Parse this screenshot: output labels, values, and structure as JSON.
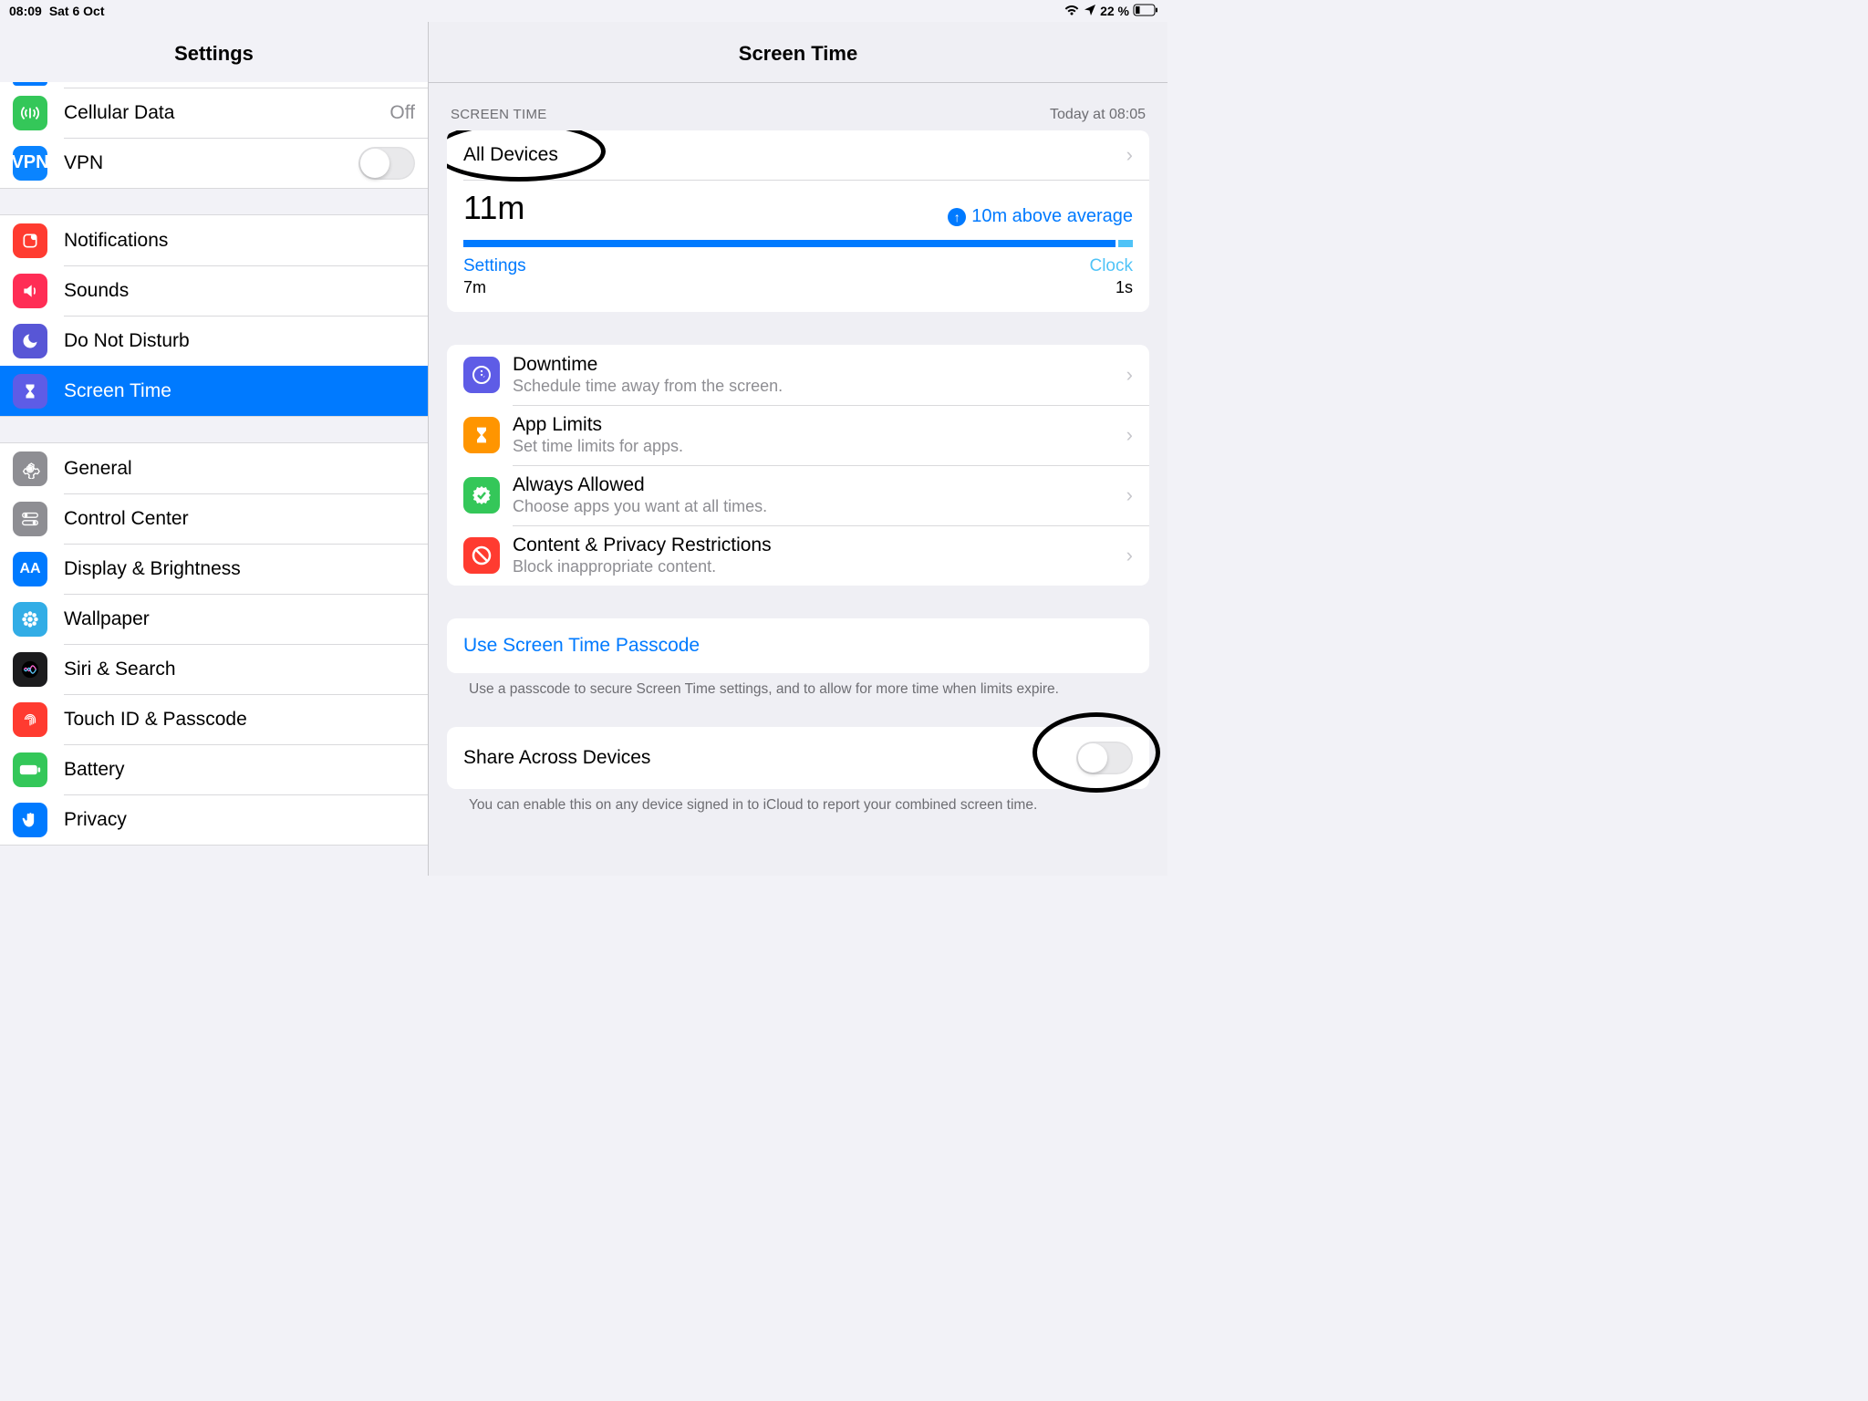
{
  "status": {
    "time": "08:09",
    "date": "Sat 6 Oct",
    "battery_pct": "22 %"
  },
  "sidebar": {
    "title": "Settings",
    "cellular": {
      "label": "Cellular Data",
      "value": "Off"
    },
    "vpn": {
      "label": "VPN",
      "icon_text": "VPN"
    },
    "notifications": "Notifications",
    "sounds": "Sounds",
    "dnd": "Do Not Disturb",
    "screentime": "Screen Time",
    "general": "General",
    "control_center": "Control Center",
    "display": "Display & Brightness",
    "wallpaper": "Wallpaper",
    "siri": "Siri & Search",
    "touchid": "Touch ID & Passcode",
    "battery": "Battery",
    "privacy": "Privacy"
  },
  "detail": {
    "title": "Screen Time",
    "section_label": "SCREEN TIME",
    "updated": "Today at 08:05",
    "all_devices": "All Devices",
    "usage_total": "11m",
    "above_avg": "10m above average",
    "app1": {
      "name": "Settings",
      "time": "7m"
    },
    "app2": {
      "name": "Clock",
      "time": "1s"
    },
    "options": {
      "downtime": {
        "title": "Downtime",
        "sub": "Schedule time away from the screen."
      },
      "applimits": {
        "title": "App Limits",
        "sub": "Set time limits for apps."
      },
      "always": {
        "title": "Always Allowed",
        "sub": "Choose apps you want at all times."
      },
      "content": {
        "title": "Content & Privacy Restrictions",
        "sub": "Block inappropriate content."
      }
    },
    "passcode_link": "Use Screen Time Passcode",
    "passcode_footer": "Use a passcode to secure Screen Time settings, and to allow for more time when limits expire.",
    "share_label": "Share Across Devices",
    "share_footer": "You can enable this on any device signed in to iCloud to report your combined screen time."
  }
}
